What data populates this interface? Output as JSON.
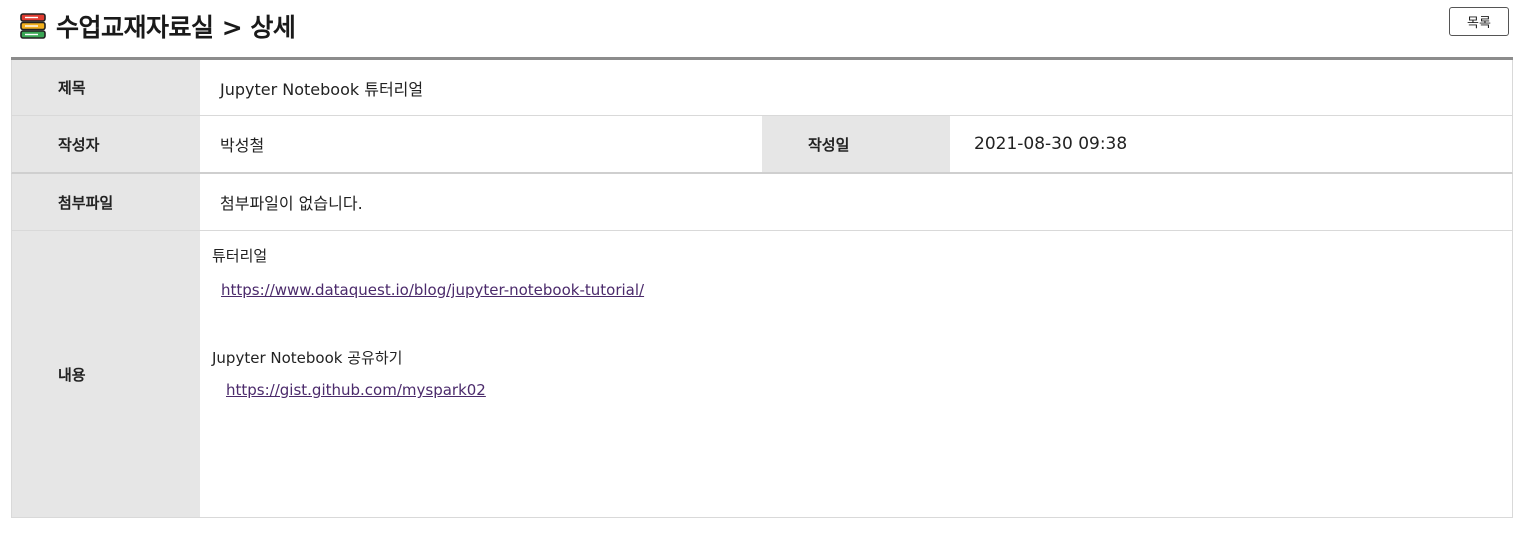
{
  "header": {
    "title": "수업교재자료실 > 상세",
    "icon": "stacked-books-icon"
  },
  "toolbar": {
    "list_label": "목록"
  },
  "detail": {
    "title_label": "제목",
    "title_value": "Jupyter Notebook 튜터리얼",
    "author_label": "작성자",
    "author_value": "박성철",
    "date_label": "작성일",
    "date_value": "2021-08-30 09:38",
    "attachment_label": "첨부파일",
    "attachment_value": "첨부파일이 없습니다.",
    "content_label": "내용",
    "content": {
      "line1": "튜터리얼",
      "link1": "https://www.dataquest.io/blog/jupyter-notebook-tutorial/",
      "line2": "Jupyter Notebook 공유하기",
      "link2": "https://gist.github.com/myspark02"
    }
  },
  "colors": {
    "header_cell_bg": "#e6e6e6",
    "link_color": "#4b2a6b",
    "top_border": "#8c8c8c"
  }
}
